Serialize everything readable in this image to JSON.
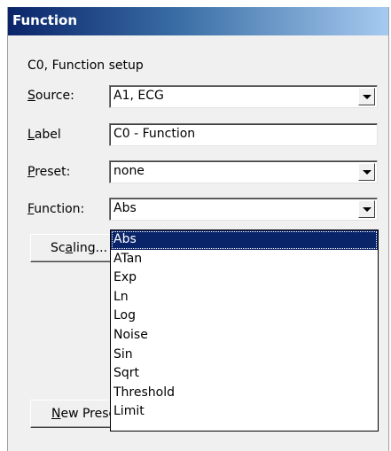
{
  "window": {
    "title": "Function"
  },
  "subtitle": "C0, Function setup",
  "source": {
    "label_pre": "",
    "label_u": "S",
    "label_post": "ource:",
    "value": "A1, ECG"
  },
  "label_field": {
    "label_pre": "",
    "label_u": "L",
    "label_post": "abel",
    "value": "C0 - Function"
  },
  "preset": {
    "label_pre": "",
    "label_u": "P",
    "label_post": "reset:",
    "value": "none"
  },
  "function": {
    "label_pre": "",
    "label_u": "F",
    "label_post": "unction:",
    "value": "Abs"
  },
  "buttons": {
    "scaling": {
      "pre": "Sc",
      "u": "a",
      "post": "ling..."
    },
    "new_preset": {
      "pre": "",
      "u": "N",
      "post": "ew Preset..."
    }
  },
  "function_options": [
    "Abs",
    "ATan",
    "Exp",
    "Ln",
    "Log",
    "Noise",
    "Sin",
    "Sqrt",
    "Threshold",
    "Limit"
  ],
  "selected_index": 0,
  "colors": {
    "highlight": "#0a246a",
    "title_gradient_start": "#0a246a",
    "title_gradient_end": "#a6caf0"
  }
}
